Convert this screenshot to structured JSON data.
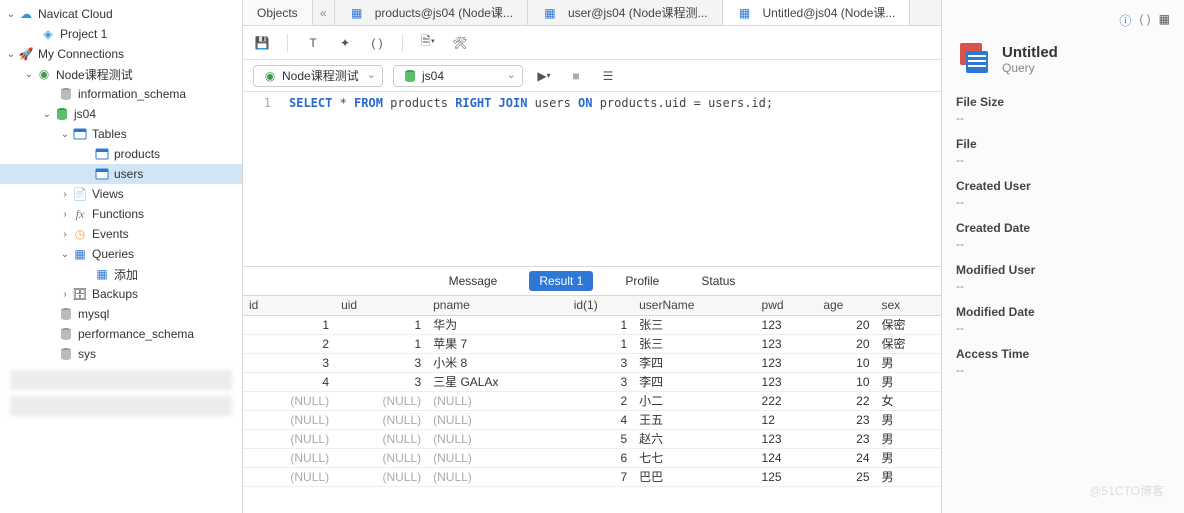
{
  "tree": {
    "navicat": "Navicat Cloud",
    "project": "Project 1",
    "my_conn": "My Connections",
    "conn": "Node课程测试",
    "db_info": "information_schema",
    "db_js04": "js04",
    "n_tables": "Tables",
    "t_products": "products",
    "t_users": "users",
    "n_views": "Views",
    "n_functions": "Functions",
    "n_events": "Events",
    "n_queries": "Queries",
    "q_add": "添加",
    "n_backups": "Backups",
    "db_mysql": "mysql",
    "db_perf": "performance_schema",
    "db_sys": "sys"
  },
  "tabs": {
    "objects": "Objects",
    "t1": "products@js04 (Node课...",
    "t2": "user@js04 (Node课程测...",
    "t3": "Untitled@js04 (Node课..."
  },
  "dd": {
    "conn": "Node课程测试",
    "db": "js04"
  },
  "sql": {
    "line": "1",
    "k_select": "SELECT",
    "star": " * ",
    "k_from": "FROM",
    "t1": "  products ",
    "k_join": "RIGHT JOIN",
    "t2": "  users ",
    "k_on": "ON",
    "rest": " products.uid = users.id;"
  },
  "rtabs": {
    "msg": "Message",
    "res": "Result 1",
    "prof": "Profile",
    "stat": "Status"
  },
  "cols": [
    "id",
    "uid",
    "pname",
    "id(1)",
    "userName",
    "pwd",
    "age",
    "sex"
  ],
  "rows": [
    [
      "1",
      "1",
      "华为",
      "1",
      "张三",
      "123",
      "20",
      "保密"
    ],
    [
      "2",
      "1",
      "苹果 7",
      "1",
      "张三",
      "123",
      "20",
      "保密"
    ],
    [
      "3",
      "3",
      "小米 8",
      "3",
      "李四",
      "123",
      "10",
      "男"
    ],
    [
      "4",
      "3",
      "三星 GALAx",
      "3",
      "李四",
      "123",
      "10",
      "男"
    ],
    [
      "(NULL)",
      "(NULL)",
      "(NULL)",
      "2",
      "小二",
      "222",
      "22",
      "女"
    ],
    [
      "(NULL)",
      "(NULL)",
      "(NULL)",
      "4",
      "王五",
      "12",
      "23",
      "男"
    ],
    [
      "(NULL)",
      "(NULL)",
      "(NULL)",
      "5",
      "赵六",
      "123",
      "23",
      "男"
    ],
    [
      "(NULL)",
      "(NULL)",
      "(NULL)",
      "6",
      "七七",
      "124",
      "24",
      "男"
    ],
    [
      "(NULL)",
      "(NULL)",
      "(NULL)",
      "7",
      "巴巴",
      "125",
      "25",
      "男"
    ]
  ],
  "props": {
    "title": "Untitled",
    "sub": "Query",
    "labels": [
      "File Size",
      "File",
      "Created User",
      "Created Date",
      "Modified User",
      "Modified Date",
      "Access Time"
    ],
    "vals": [
      "--",
      "--",
      "--",
      "--",
      "--",
      "--",
      "--"
    ]
  },
  "wm": "@51CTO博客"
}
